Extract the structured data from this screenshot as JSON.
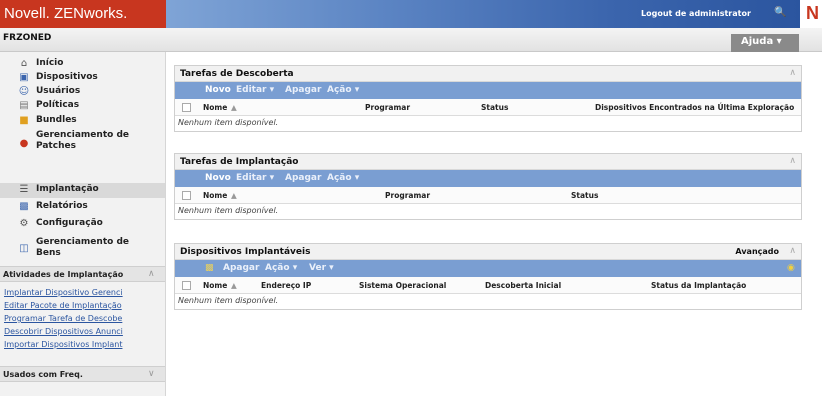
{
  "header": {
    "brand": "Novell. ZENworks.",
    "logout": "Logout de administrator",
    "zone": "FRZONED",
    "help": "Ajuda ▾"
  },
  "sidebar": {
    "items": [
      {
        "label": "Início",
        "icon": "home-icon"
      },
      {
        "label": "Dispositivos",
        "icon": "computer-icon"
      },
      {
        "label": "Usuários",
        "icon": "users-icon"
      },
      {
        "label": "Políticas",
        "icon": "policy-icon"
      },
      {
        "label": "Bundles",
        "icon": "bundle-icon"
      },
      {
        "label": "Gerenciamento de Patches",
        "icon": "patch-icon"
      },
      {
        "label": "Implantação",
        "icon": "deployment-icon"
      },
      {
        "label": "Relatórios",
        "icon": "reports-icon"
      },
      {
        "label": "Configuração",
        "icon": "gear-icon"
      },
      {
        "label": "Gerenciamento de Bens",
        "icon": "asset-icon"
      }
    ],
    "tasks_title": "Atividades de Implantação",
    "tasks": [
      "Implantar Dispositivo Gerenci",
      "Editar Pacote de Implantação",
      "Programar Tarefa de Descobe",
      "Descobrir Dispositivos Anunci",
      "Importar Dispositivos Implant"
    ],
    "frequent_title": "Usados com Freq."
  },
  "discovery": {
    "title": "Tarefas de Descoberta",
    "toolbar": {
      "new": "Novo",
      "edit": "Editar ▾",
      "delete": "Apagar",
      "action": "Ação ▾"
    },
    "columns": [
      "Nome",
      "Programar",
      "Status",
      "Dispositivos Encontrados na Última Exploração"
    ],
    "empty": "Nenhum item disponível."
  },
  "deployment": {
    "title": "Tarefas de Implantação",
    "toolbar": {
      "new": "Novo",
      "edit": "Editar ▾",
      "delete": "Apagar",
      "action": "Ação ▾"
    },
    "columns": [
      "Nome",
      "Programar",
      "Status"
    ],
    "empty": "Nenhum item disponível."
  },
  "devices": {
    "title": "Dispositivos Implantáveis",
    "advanced": "Avançado",
    "toolbar": {
      "delete": "Apagar",
      "action": "Ação ▾",
      "view": "Ver ▾"
    },
    "columns": [
      "Nome",
      "Endereço IP",
      "Sistema Operacional",
      "Descoberta Inicial",
      "Status da Implantação"
    ],
    "empty": "Nenhum item disponível."
  }
}
